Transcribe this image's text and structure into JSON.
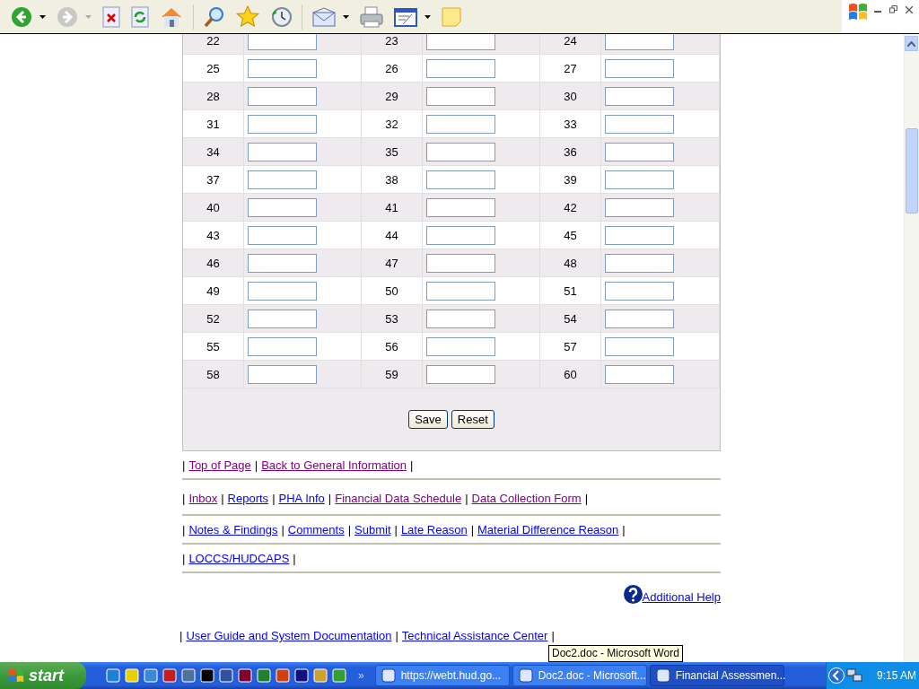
{
  "form": {
    "rows": [
      [
        "22",
        "23",
        "24"
      ],
      [
        "25",
        "26",
        "27"
      ],
      [
        "28",
        "29",
        "30"
      ],
      [
        "31",
        "32",
        "33"
      ],
      [
        "34",
        "35",
        "36"
      ],
      [
        "37",
        "38",
        "39"
      ],
      [
        "40",
        "41",
        "42"
      ],
      [
        "43",
        "44",
        "45"
      ],
      [
        "46",
        "47",
        "48"
      ],
      [
        "49",
        "50",
        "51"
      ],
      [
        "52",
        "53",
        "54"
      ],
      [
        "55",
        "56",
        "57"
      ],
      [
        "58",
        "59",
        "60"
      ]
    ],
    "buttons": [
      "Save",
      "Reset"
    ]
  },
  "link_rows": [
    [
      {
        "label": "Top of Page",
        "visited": true
      },
      {
        "label": "Back to General Information",
        "visited": true
      }
    ],
    [
      {
        "label": "Inbox",
        "visited": true
      },
      {
        "label": "Reports",
        "visited": false
      },
      {
        "label": "PHA Info",
        "visited": false
      },
      {
        "label": "Financial Data Schedule",
        "visited": true
      },
      {
        "label": "Data Collection Form",
        "visited": true
      }
    ],
    [
      {
        "label": "Notes & Findings",
        "visited": false
      },
      {
        "label": "Comments",
        "visited": false
      },
      {
        "label": "Submit",
        "visited": false
      },
      {
        "label": "Late Reason",
        "visited": false
      },
      {
        "label": "Material Difference Reason",
        "visited": false
      }
    ],
    [
      {
        "label": "LOCCS/HUDCAPS",
        "visited": false
      }
    ]
  ],
  "help_link": "Additional Help",
  "footer_links": [
    {
      "label": "User Guide and System Documentation",
      "visited": false
    },
    {
      "label": "Technical Assistance Center",
      "visited": false
    }
  ],
  "separator": "|",
  "tooltip": "Doc2.doc - Microsoft Word",
  "taskbar": {
    "start": "start",
    "overflow": "»",
    "tasks": [
      {
        "label": "https://webt.hud.go...",
        "selected": false
      },
      {
        "label": "Doc2.doc - Microsoft...",
        "selected": false
      },
      {
        "label": "Financial Assessmen...",
        "selected": true
      }
    ],
    "clock": "9:15 AM"
  }
}
